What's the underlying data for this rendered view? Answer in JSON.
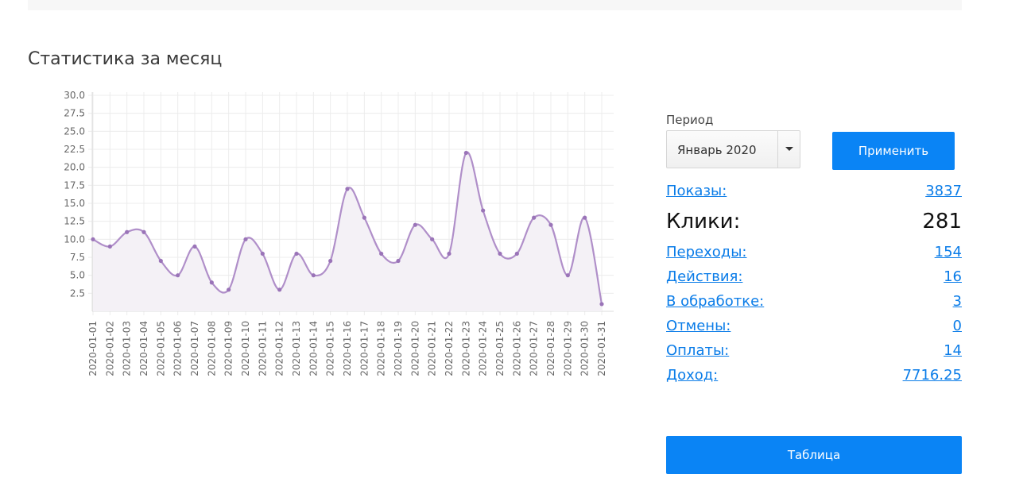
{
  "section_title": "Статистика за месяц",
  "period": {
    "label": "Период",
    "selected": "Январь 2020"
  },
  "apply_label": "Применить",
  "table_label": "Таблица",
  "stats": {
    "shows": {
      "label": "Показы:",
      "value": "3837"
    },
    "clicks": {
      "label": "Клики:",
      "value": "281"
    },
    "transitions": {
      "label": "Переходы:",
      "value": "154"
    },
    "actions": {
      "label": "Действия:",
      "value": "16"
    },
    "processing": {
      "label": "В обработке:",
      "value": "3"
    },
    "cancels": {
      "label": "Отмены:",
      "value": "0"
    },
    "payments": {
      "label": "Оплаты:",
      "value": "14"
    },
    "income": {
      "label": "Доход:",
      "value": "7716.25"
    }
  },
  "colors": {
    "line": "#b08fc9",
    "fill": "#f4f1f6",
    "accent": "#0a84f5",
    "link": "#0a7ce8"
  },
  "chart_data": {
    "type": "line",
    "title": "",
    "xlabel": "",
    "ylabel": "",
    "ylim": [
      0,
      30
    ],
    "yticks": [
      "2.5",
      "5.0",
      "7.5",
      "10.0",
      "12.5",
      "15.0",
      "17.5",
      "20.0",
      "22.5",
      "25.0",
      "27.5",
      "30.0"
    ],
    "grid": true,
    "categories": [
      "2020-01-01",
      "2020-01-02",
      "2020-01-03",
      "2020-01-04",
      "2020-01-05",
      "2020-01-06",
      "2020-01-07",
      "2020-01-08",
      "2020-01-09",
      "2020-01-10",
      "2020-01-11",
      "2020-01-12",
      "2020-01-13",
      "2020-01-14",
      "2020-01-15",
      "2020-01-16",
      "2020-01-17",
      "2020-01-18",
      "2020-01-19",
      "2020-01-20",
      "2020-01-21",
      "2020-01-22",
      "2020-01-23",
      "2020-01-24",
      "2020-01-25",
      "2020-01-26",
      "2020-01-27",
      "2020-01-28",
      "2020-01-29",
      "2020-01-30",
      "2020-01-31"
    ],
    "values": [
      10,
      9,
      11,
      11,
      7,
      5,
      9,
      4,
      3,
      10,
      8,
      3,
      8,
      5,
      7,
      17,
      13,
      8,
      7,
      12,
      10,
      8,
      22,
      14,
      8,
      8,
      13,
      12,
      5,
      13,
      1
    ]
  }
}
